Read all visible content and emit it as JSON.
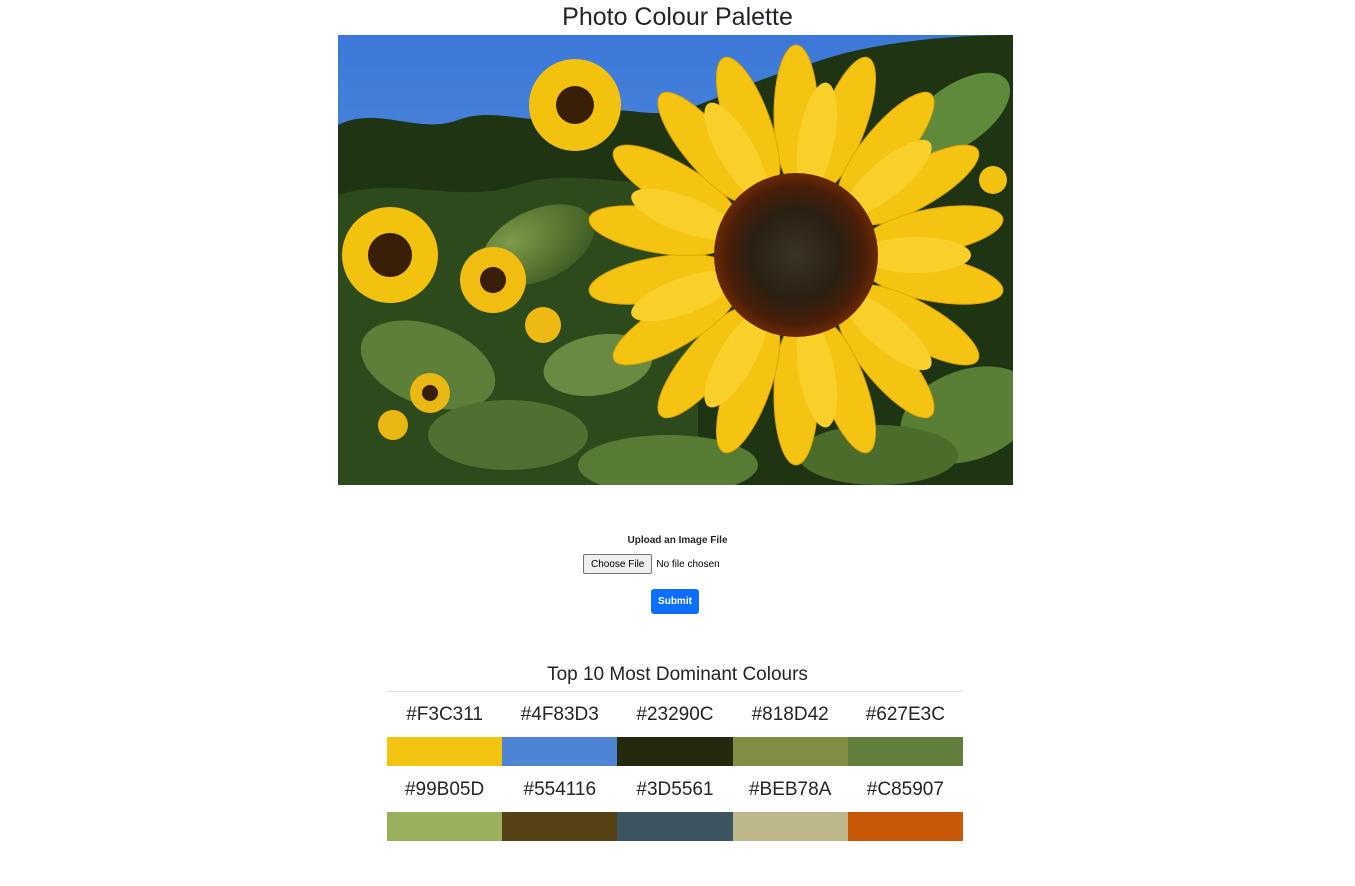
{
  "page": {
    "title": "Photo Colour Palette"
  },
  "upload": {
    "label": "Upload an Image File",
    "choose_button": "Choose File",
    "file_status": "No file chosen",
    "submit_button": "Submit"
  },
  "palette": {
    "title": "Top 10 Most Dominant Colours",
    "colours": [
      {
        "hex": "#F3C311"
      },
      {
        "hex": "#4F83D3"
      },
      {
        "hex": "#23290C"
      },
      {
        "hex": "#818D42"
      },
      {
        "hex": "#627E3C"
      },
      {
        "hex": "#99B05D"
      },
      {
        "hex": "#554116"
      },
      {
        "hex": "#3D5561"
      },
      {
        "hex": "#BEB78A"
      },
      {
        "hex": "#C85907"
      }
    ]
  },
  "colors": {
    "submit_bg": "#0d6efd"
  }
}
